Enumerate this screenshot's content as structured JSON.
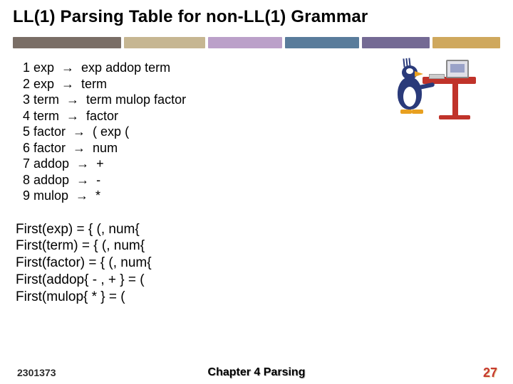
{
  "title": "LL(1) Parsing Table for non-LL(1) Grammar",
  "grammar": [
    {
      "num": "1",
      "lhs": "exp",
      "rhs": "exp addop term"
    },
    {
      "num": "2",
      "lhs": "exp",
      "rhs": "term"
    },
    {
      "num": "3",
      "lhs": "term",
      "rhs": "term mulop factor"
    },
    {
      "num": "4",
      "lhs": "term",
      "rhs": "factor"
    },
    {
      "num": "5",
      "lhs": "factor",
      "rhs": "( exp ("
    },
    {
      "num": "6",
      "lhs": "factor",
      "rhs": "num"
    },
    {
      "num": "7",
      "lhs": "addop",
      "rhs": "+"
    },
    {
      "num": "8",
      "lhs": "addop",
      "rhs": "-"
    },
    {
      "num": "9",
      "lhs": "mulop",
      "rhs": "*"
    }
  ],
  "arrow": "→",
  "first": [
    "First(exp) = { (, num{",
    "First(term) = { (, num{",
    "First(factor) = { (, num{",
    "First(addop{ - , + } = (",
    "First(mulop{ * } = ("
  ],
  "footer": {
    "left": "2301373",
    "center": "Chapter 4   Parsing",
    "right": "27"
  }
}
